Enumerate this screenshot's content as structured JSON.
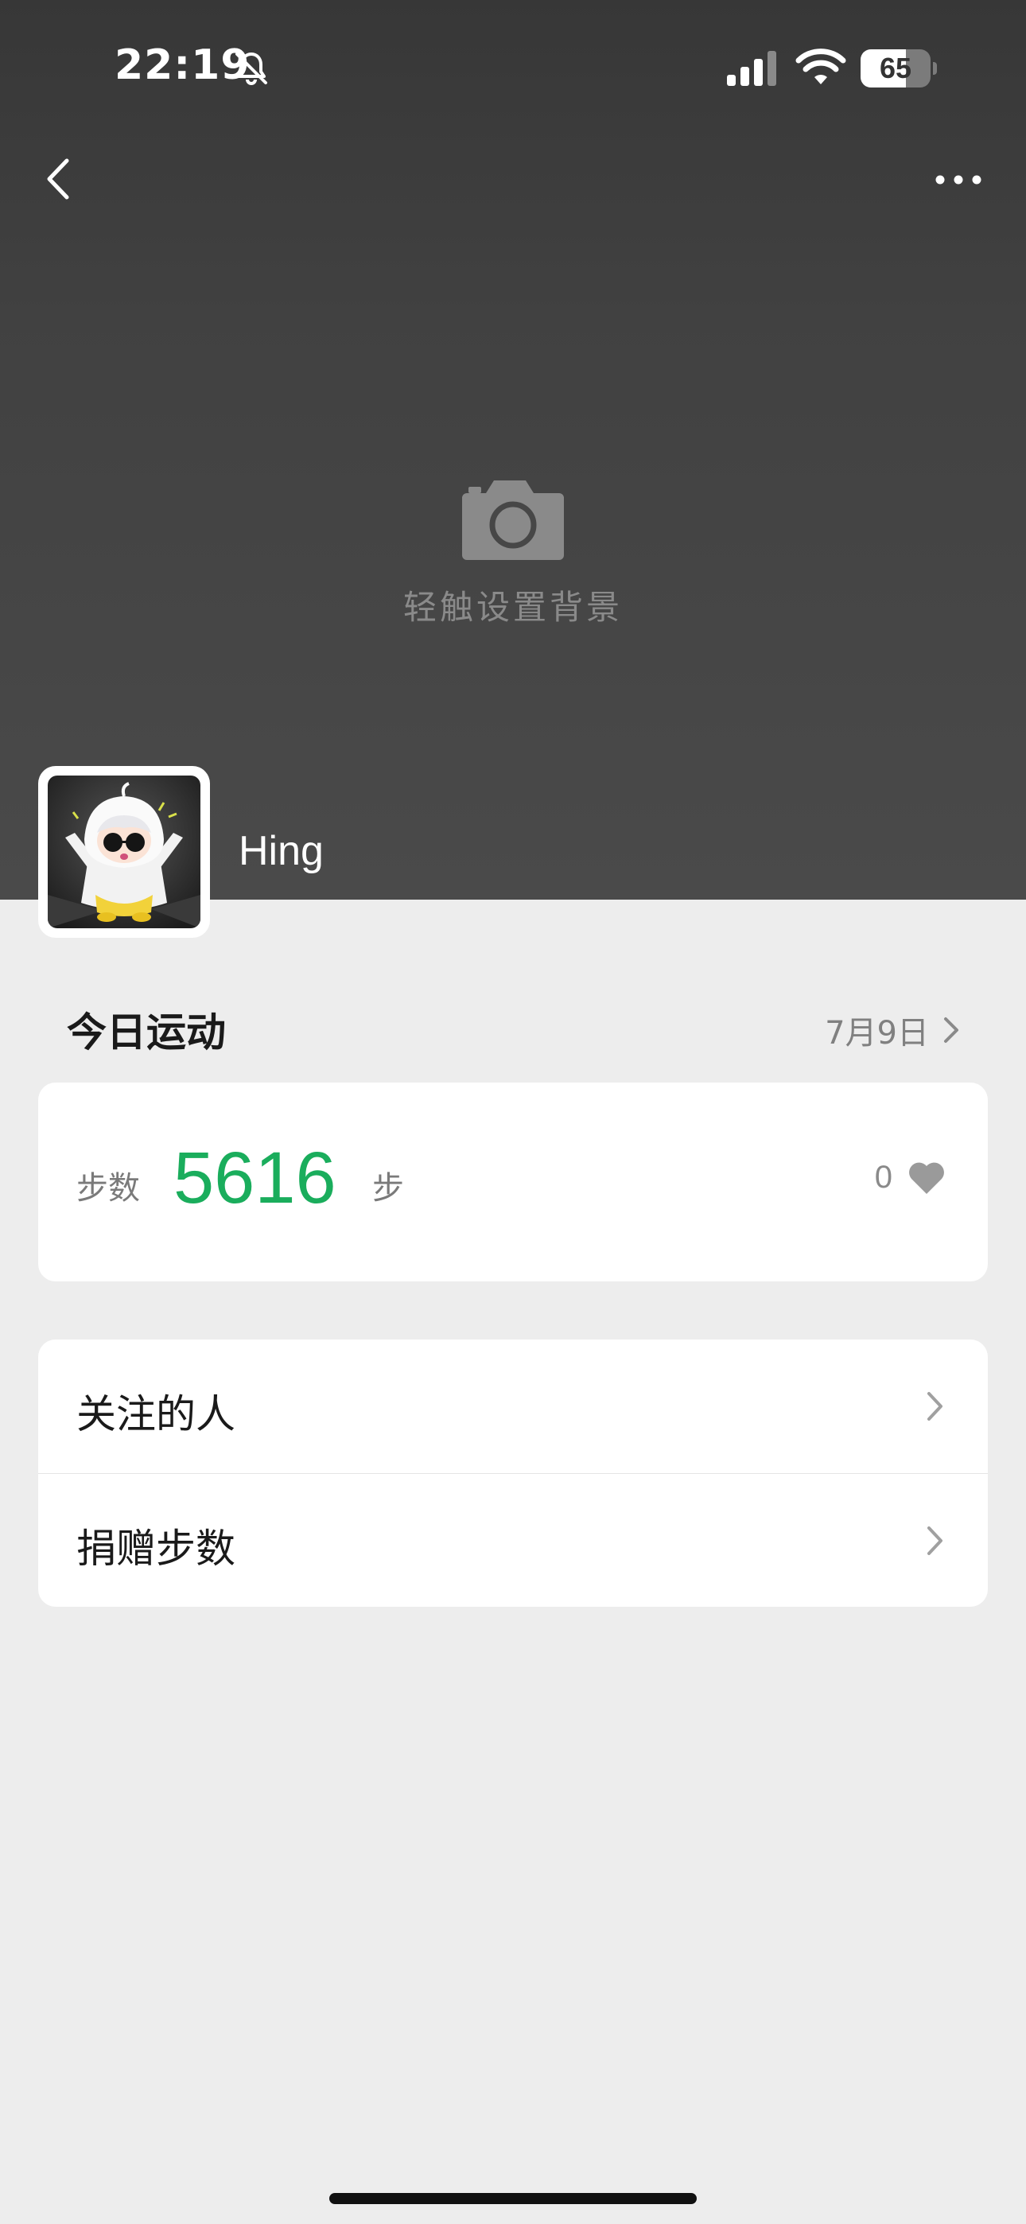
{
  "status_bar": {
    "time": "22:19",
    "battery_level": "65",
    "battery_fraction": 0.65,
    "icons": [
      "bell-muted-icon",
      "signal-icon",
      "wifi-icon",
      "battery-icon"
    ]
  },
  "nav": {
    "back_icon": "chevron-left-icon",
    "more_icon": "more-dots-icon"
  },
  "cover": {
    "set_background_label": "轻触设置背景",
    "camera_icon": "camera-icon"
  },
  "profile": {
    "name": "Hing",
    "avatar": "avatar-illustration"
  },
  "today": {
    "title": "今日运动",
    "date": "7月9日",
    "steps_label": "步数",
    "steps_value": "5616",
    "steps_unit": "步",
    "likes_count": "0"
  },
  "menu": {
    "items": [
      {
        "label": "关注的人"
      },
      {
        "label": "捐赠步数"
      }
    ]
  },
  "colors": {
    "accent_green": "#1aad5c",
    "cover_dark": "#3d3d3d",
    "page_background": "#ededed"
  }
}
